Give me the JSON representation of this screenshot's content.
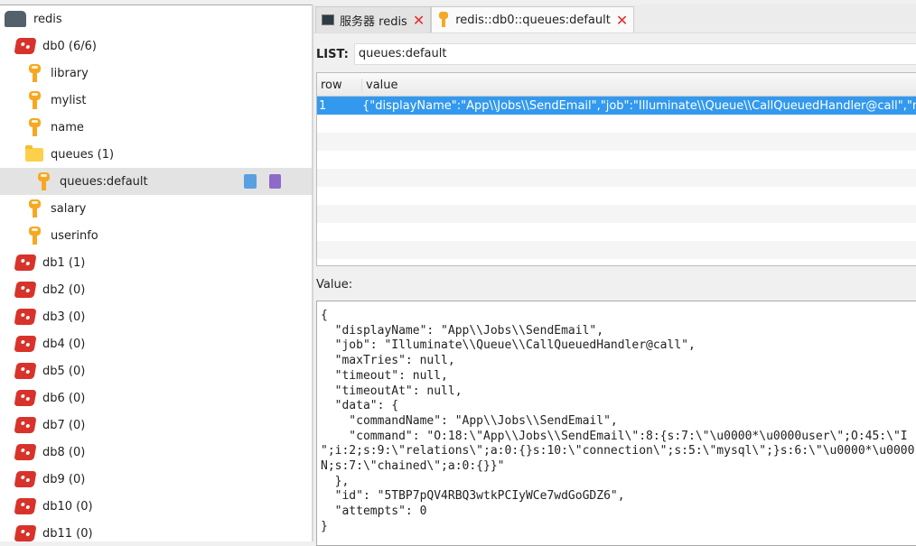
{
  "tree": {
    "server": "redis",
    "db0": "db0  (6/6)",
    "keys0": [
      "library",
      "mylist",
      "name"
    ],
    "folder": "queues (1)",
    "selected_key": "queues:default",
    "keys1": [
      "salary",
      "userinfo"
    ],
    "dbs": [
      "db1 (1)",
      "db2 (0)",
      "db3 (0)",
      "db4 (0)",
      "db5 (0)",
      "db6 (0)",
      "db7 (0)",
      "db8 (0)",
      "db9 (0)",
      "db10 (0)",
      "db11 (0)"
    ]
  },
  "tabs": [
    {
      "label": "服务器 redis"
    },
    {
      "label": "redis::db0::queues:default"
    }
  ],
  "list": {
    "type_label": "LIST:",
    "key": "queues:default"
  },
  "table": {
    "headers": [
      "row",
      "value"
    ],
    "rows": [
      {
        "row": "1",
        "value": "{\"displayName\":\"App\\\\Jobs\\\\SendEmail\",\"job\":\"Illuminate\\\\Queue\\\\CallQueuedHandler@call\",\"maxTries\""
      }
    ]
  },
  "value": {
    "label": "Value:",
    "lines": [
      "{",
      "  \"displayName\": \"App\\\\Jobs\\\\SendEmail\",",
      "  \"job\": \"Illuminate\\\\Queue\\\\CallQueuedHandler@call\",",
      "  \"maxTries\": null,",
      "  \"timeout\": null,",
      "  \"timeoutAt\": null,",
      "  \"data\": {",
      "    \"commandName\": \"App\\\\Jobs\\\\SendEmail\",",
      "    \"command\": \"O:18:\\\"App\\\\Jobs\\\\SendEmail\\\":8:{s:7:\\\"\\u0000*\\u0000user\\\";O:45:\\\"I",
      "\";i:2;s:9:\\\"relations\\\";a:0:{}s:10:\\\"connection\\\";s:5:\\\"mysql\\\";}s:6:\\\"\\u0000*\\u0000",
      "N;s:7:\\\"chained\\\";a:0:{}}\"",
      "  },",
      "  \"id\": \"5TBP7pQV4RBQ3wtkPCIyWCe7wdGoGDZ6\",",
      "  \"attempts\": 0",
      "}"
    ]
  }
}
